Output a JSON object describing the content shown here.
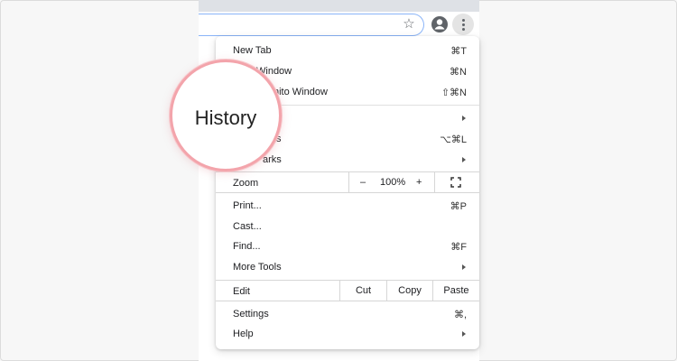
{
  "menu": {
    "new_tab": {
      "label": "New Tab",
      "shortcut": "⌘T"
    },
    "new_window": {
      "label": "Window",
      "shortcut": "⌘N"
    },
    "new_incognito": {
      "label": "nito Window",
      "shortcut": "⇧⌘N"
    },
    "history_shortcut_clip": "s",
    "downloads_shortcut": "⌥⌘L",
    "bookmarks_clip": "arks",
    "zoom": {
      "label": "Zoom",
      "minus": "–",
      "value": "100%",
      "plus": "+"
    },
    "print": {
      "label": "Print...",
      "shortcut": "⌘P"
    },
    "cast": {
      "label": "Cast..."
    },
    "find": {
      "label": "Find...",
      "shortcut": "⌘F"
    },
    "more_tools": {
      "label": "More Tools"
    },
    "edit": {
      "label": "Edit",
      "cut": "Cut",
      "copy": "Copy",
      "paste": "Paste"
    },
    "settings": {
      "label": "Settings",
      "shortcut": "⌘,"
    },
    "help": {
      "label": "Help"
    }
  },
  "magnifier": {
    "text": "History"
  },
  "colors": {
    "accent_ring": "#f3a4ab",
    "omnibox_border": "#8ab4f8"
  }
}
